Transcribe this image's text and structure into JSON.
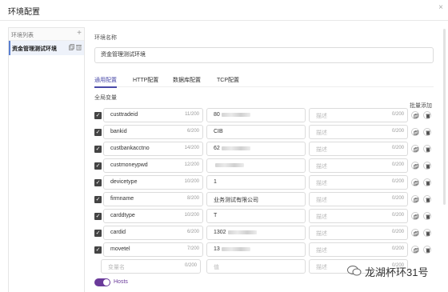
{
  "dialog": {
    "title": "环境配置",
    "close": "×"
  },
  "sidebar": {
    "header": "环境列表",
    "add": "+",
    "items": [
      {
        "label": "资金管理测试环境"
      }
    ]
  },
  "env": {
    "label": "环境名称",
    "value": "资金管理测试环境"
  },
  "tabs": [
    {
      "label": "通用配置",
      "active": true
    },
    {
      "label": "HTTP配置",
      "active": false
    },
    {
      "label": "数据库配置",
      "active": false
    },
    {
      "label": "TCP配置",
      "active": false
    }
  ],
  "section": {
    "label": "全局变量",
    "batch_add": "批量添加"
  },
  "variables": [
    {
      "name": "custtradeid",
      "name_count": "11/200",
      "value": "80",
      "value_blurred": true,
      "desc_placeholder": "描述",
      "desc_count": "0/200"
    },
    {
      "name": "bankid",
      "name_count": "6/200",
      "value": "CIB",
      "value_blurred": false,
      "desc_placeholder": "描述",
      "desc_count": "0/200"
    },
    {
      "name": "custbankacctno",
      "name_count": "14/200",
      "value": "62",
      "value_blurred": true,
      "desc_placeholder": "描述",
      "desc_count": "0/200"
    },
    {
      "name": "custmoneypwd",
      "name_count": "12/200",
      "value": "",
      "value_blurred": true,
      "desc_placeholder": "描述",
      "desc_count": "0/200"
    },
    {
      "name": "devicetype",
      "name_count": "10/200",
      "value": "1",
      "value_blurred": false,
      "desc_placeholder": "描述",
      "desc_count": "0/200"
    },
    {
      "name": "firmname",
      "name_count": "8/200",
      "value": "业务测试有限公司",
      "value_blurred": false,
      "desc_placeholder": "描述",
      "desc_count": "0/200"
    },
    {
      "name": "carddtype",
      "name_count": "10/200",
      "value": "T",
      "value_blurred": false,
      "desc_placeholder": "描述",
      "desc_count": "0/200"
    },
    {
      "name": "cardid",
      "name_count": "6/200",
      "value": "1302",
      "value_blurred": true,
      "desc_placeholder": "描述",
      "desc_count": "0/200"
    },
    {
      "name": "movetel",
      "name_count": "7/200",
      "value": "13",
      "value_blurred": true,
      "desc_placeholder": "描述",
      "desc_count": "0/200"
    }
  ],
  "new_row": {
    "name_placeholder": "变量名",
    "name_count": "0/200",
    "value_placeholder": "值",
    "desc_placeholder": "描述",
    "desc_count": "0/200"
  },
  "hosts": {
    "label": "Hosts",
    "enabled": true
  },
  "watermark": {
    "text": "龙湖杯环31号"
  },
  "colors": {
    "accent": "#4a4aa8",
    "toggle": "#6a3a9a",
    "sidebar_active_bg": "#eef2fa"
  }
}
